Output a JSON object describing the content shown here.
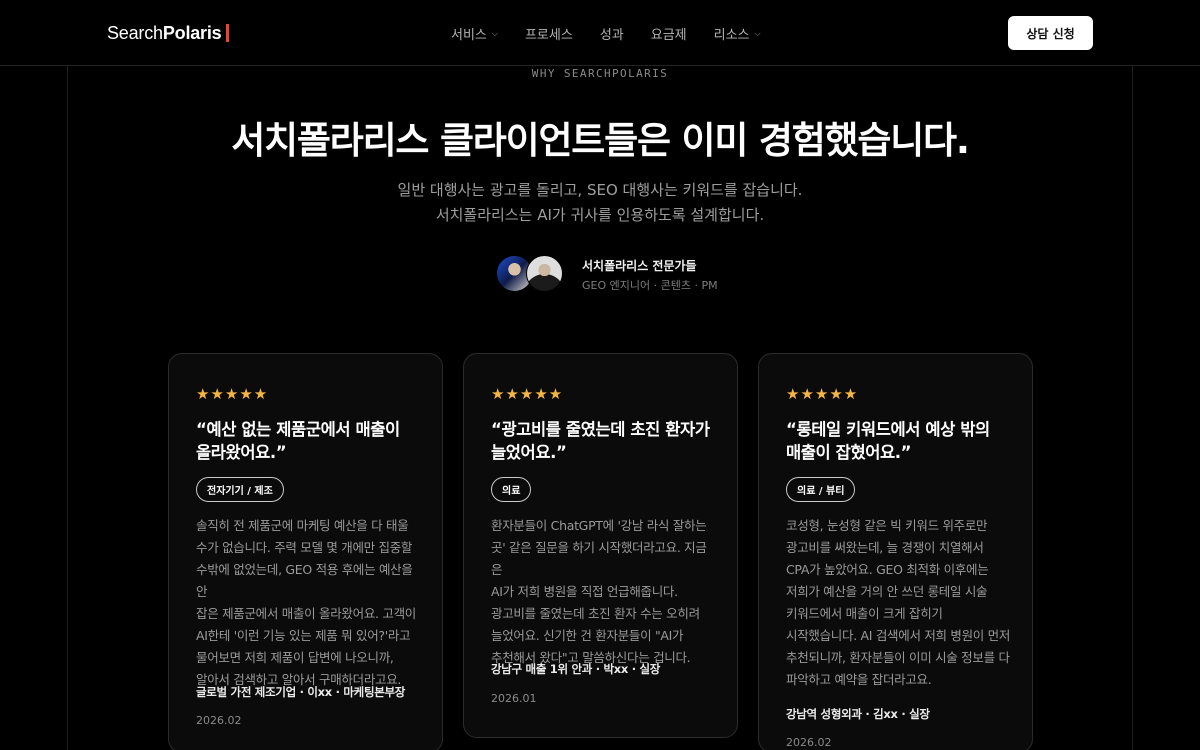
{
  "nav": {
    "logo_regular": "Search",
    "logo_bold": "Polaris",
    "menu": [
      {
        "label": "서비스",
        "dropdown": true
      },
      {
        "label": "프로세스",
        "dropdown": false
      },
      {
        "label": "성과",
        "dropdown": false
      },
      {
        "label": "요금제",
        "dropdown": false
      },
      {
        "label": "리소스",
        "dropdown": true
      }
    ],
    "cta_label": "상담 신청"
  },
  "hero": {
    "eyebrow": "WHY SEARCHPOLARIS",
    "title": "서치폴라리스 클라이언트들은 이미 경험했습니다.",
    "subtitle_line1": "일반 대행사는 광고를 돌리고, SEO 대행사는 키워드를 잡습니다.",
    "subtitle_line2": "서치폴라리스는 AI가 귀사를 인용하도록 설계합니다."
  },
  "team": {
    "name": "서치폴라리스 전문가들",
    "roles": "GEO 엔지니어 · 콘텐츠 · PM"
  },
  "colors": {
    "background": "#000000",
    "star": "#f4b544",
    "logo_accent": "#e8452c"
  },
  "testimonials": [
    {
      "stars": "★★★★★",
      "quote": "“예산 없는 제품군에서 매출이\n올라왔어요.”",
      "tag": "전자기기 / 제조",
      "body": "솔직히 전 제품군에 마케팅 예산을 다 태울\n수가 없습니다. 주력 모델 몇 개에만 집중할\n수밖에 없었는데, GEO 적용 후에는 예산을 안\n잡은 제품군에서 매출이 올라왔어요. 고객이\nAI한테 '이런 기능 있는 제품 뭐 있어?'라고\n물어보면 저희 제품이 답변에 나오니까,\n알아서 검색하고 알아서 구매하더라고요.",
      "author": "글로벌 가전 제조기업 · 이xx · 마케팅본부장",
      "date": "2026.02"
    },
    {
      "stars": "★★★★★",
      "quote": "“광고비를 줄였는데 초진 환자가\n늘었어요.”",
      "tag": "의료",
      "body": "환자분들이 ChatGPT에 '강남 라식 잘하는\n곳' 같은 질문을 하기 시작했더라고요. 지금은\nAI가 저희 병원을 직접 언급해줍니다.\n광고비를 줄였는데 초진 환자 수는 오히려\n늘었어요. 신기한 건 환자분들이 \"AI가\n추천해서 왔다\"고 말씀하신다는 겁니다.",
      "author": "강남구 매출 1위 안과 · 박xx · 실장",
      "date": "2026.01"
    },
    {
      "stars": "★★★★★",
      "quote": "“롱테일 키워드에서 예상 밖의\n매출이 잡혔어요.”",
      "tag": "의료 / 뷰티",
      "body": "코성형, 눈성형 같은 빅 키워드 위주로만\n광고비를 써왔는데, 늘 경쟁이 치열해서\nCPA가 높았어요. GEO 최적화 이후에는\n저희가 예산을 거의 안 쓰던 롱테일 시술\n키워드에서 매출이 크게 잡히기\n시작했습니다. AI 검색에서 저희 병원이 먼저\n추천되니까, 환자분들이 이미 시술 정보를 다\n파악하고 예약을 잡더라고요.",
      "author": "강남역 성형외과 · 김xx · 실장",
      "date": "2026.02"
    }
  ]
}
